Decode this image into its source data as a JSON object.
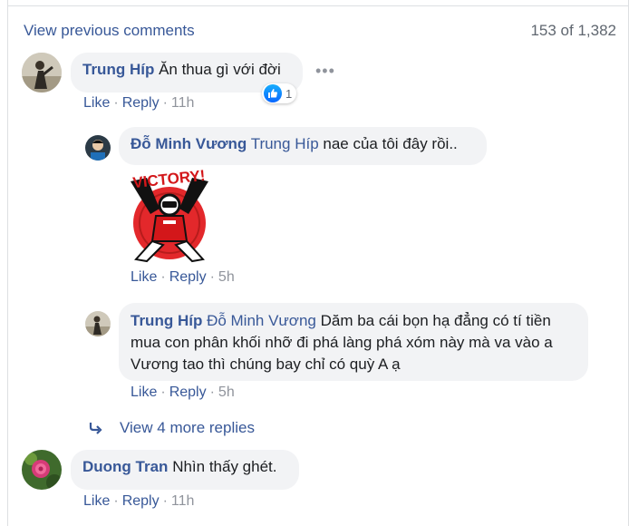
{
  "header": {
    "view_previous": "View previous comments",
    "count": "153 of 1,382"
  },
  "colors": {
    "link": "#385898",
    "meta": "#90949c",
    "bubble": "#f2f3f5",
    "like_blue": "#1877f2"
  },
  "comments": [
    {
      "name": "Trung Híp",
      "text": "Ăn thua gì với đời",
      "reaction_icon": "like-icon",
      "reaction_count": "1",
      "actions": {
        "like": "Like",
        "reply": "Reply",
        "time": "11h"
      }
    },
    {
      "name": "Đỗ Minh Vương",
      "mention": "Trung Híp",
      "text": "nae của tôi đây rồi..",
      "sticker_text": "VICTORY!",
      "actions": {
        "like": "Like",
        "reply": "Reply",
        "time": "5h"
      }
    },
    {
      "name": "Trung Híp",
      "mention": "Đỗ Minh Vương",
      "text_line1": "Dăm ba cái bọn hạ đẳng có tí tiền",
      "text_line2": "mua con phân khối nhỡ đi phá làng phá xóm này mà va vào a",
      "text_line3": "Vương tao thì chúng bay chỉ có quỳ A ạ",
      "actions": {
        "like": "Like",
        "reply": "Reply",
        "time": "5h"
      }
    },
    {
      "name": "Duong Tran",
      "text": "Nhìn thấy ghét.",
      "actions": {
        "like": "Like",
        "reply": "Reply",
        "time": "11h"
      }
    }
  ],
  "replies_link": "View 4 more replies"
}
